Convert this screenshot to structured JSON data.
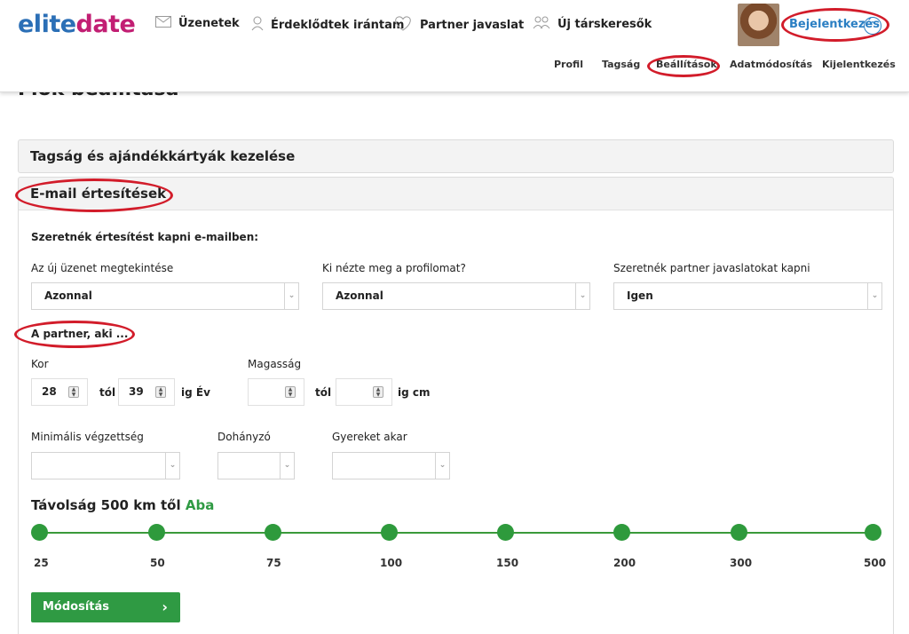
{
  "header": {
    "logo_part1": "elite",
    "logo_part2": "date",
    "nav": [
      {
        "label": "Üzenetek",
        "icon": "envelope-icon"
      },
      {
        "label": "Érdeklődtek irántam",
        "icon": "person-icon"
      },
      {
        "label": "Partner javaslat",
        "icon": "heart-icon"
      },
      {
        "label": "Új társkeresők",
        "icon": "people-icon"
      }
    ],
    "login_label": "Bejelentkezés",
    "subnav": [
      "Profil",
      "Tagság",
      "Beállítások",
      "Adatmódosítás",
      "Kijelentkezés"
    ]
  },
  "page": {
    "title": "Fiók beállítása"
  },
  "panels": {
    "membership": "Tagság és ajándékkártyák kezelése",
    "email": "E-mail értesítések"
  },
  "form": {
    "intro": "Szeretnék értesítést kapni e-mailben:",
    "fields": [
      {
        "label": "Az új üzenet megtekintése",
        "value": "Azonnal"
      },
      {
        "label": "Ki nézte meg a profilomat?",
        "value": "Azonnal"
      },
      {
        "label": "Szeretnék partner javaslatokat kapni",
        "value": "Igen"
      }
    ],
    "partner_heading": "A partner, aki ...",
    "age_label": "Kor",
    "age_from": "28",
    "from_word": "tól",
    "age_to": "39",
    "age_unit": "ig Év",
    "height_label": "Magasság",
    "height_from": "",
    "height_to": "",
    "height_unit": "ig cm",
    "education_label": "Minimális végzettség",
    "smoking_label": "Dohányzó",
    "children_label": "Gyereket akar",
    "distance_text": "Távolság 500 km től",
    "distance_city": "Aba",
    "distance_ticks": [
      "25",
      "50",
      "75",
      "100",
      "150",
      "200",
      "300",
      "500"
    ],
    "submit_label": "Módosítás"
  },
  "colors": {
    "accent_green": "#2f9a43",
    "brand_blue": "#2b6fb6",
    "brand_magenta": "#c21e73",
    "annotation_red": "#d21c2a"
  }
}
